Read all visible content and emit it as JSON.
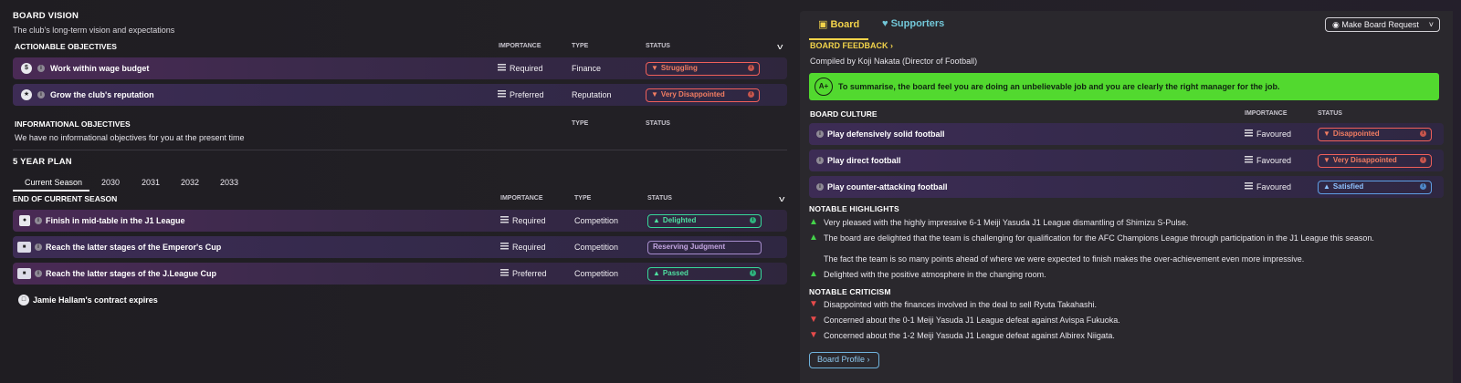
{
  "vision": {
    "title": "BOARD VISION",
    "subtitle": "The club's long-term vision and expectations"
  },
  "actionable": {
    "header": "ACTIONABLE OBJECTIVES",
    "col_importance": "IMPORTANCE",
    "col_type": "TYPE",
    "col_status": "STATUS",
    "items": [
      {
        "label": "Work within wage budget",
        "importance": "Required",
        "type": "Finance",
        "status": "Struggling",
        "status_color": "#f0605a"
      },
      {
        "label": "Grow the club's reputation",
        "importance": "Preferred",
        "type": "Reputation",
        "status": "Very Disappointed",
        "status_color": "#f0605a"
      }
    ]
  },
  "informational": {
    "header": "INFORMATIONAL OBJECTIVES",
    "col_type": "TYPE",
    "col_status": "STATUS",
    "text": "We have no informational objectives for you at the present time"
  },
  "plan": {
    "header": "5 YEAR PLAN",
    "tabs": [
      "Current Season",
      "2030",
      "2031",
      "2032",
      "2033"
    ],
    "section_header": "END OF CURRENT SEASON",
    "col_importance": "IMPORTANCE",
    "col_type": "TYPE",
    "col_status": "STATUS",
    "items": [
      {
        "label": "Finish in mid-table in the J1 League",
        "importance": "Required",
        "type": "Competition",
        "status": "Delighted",
        "status_color": "#37d89a"
      },
      {
        "label": "Reach the latter stages of the Emperor's Cup",
        "importance": "Required",
        "type": "Competition",
        "status": "Reserving Judgment",
        "status_color": "#a68ccc"
      },
      {
        "label": "Reach the latter stages of the J.League Cup",
        "importance": "Preferred",
        "type": "Competition",
        "status": "Passed",
        "status_color": "#37d89a"
      }
    ],
    "contract_note": "Jamie Hallam's contract expires"
  },
  "right": {
    "tab_board": "Board",
    "tab_supporters": "Supporters",
    "request_button": "Make Board Request",
    "feedback_title": "BOARD FEEDBACK",
    "compiled_by": "Compiled by Koji Nakata (Director of Football)",
    "grade": "A+",
    "summary": "To summarise, the board feel you are doing an unbelievable job and you are clearly the right manager for the job.",
    "culture": {
      "header": "BOARD CULTURE",
      "col_importance": "IMPORTANCE",
      "col_status": "STATUS",
      "items": [
        {
          "label": "Play defensively solid football",
          "importance": "Favoured",
          "status": "Disappointed",
          "status_color": "#f0605a"
        },
        {
          "label": "Play direct football",
          "importance": "Favoured",
          "status": "Very Disappointed",
          "status_color": "#f0605a"
        },
        {
          "label": "Play counter-attacking football",
          "importance": "Favoured",
          "status": "Satisfied",
          "status_color": "#5f9fe6"
        }
      ]
    },
    "highlights": {
      "header": "NOTABLE HIGHLIGHTS",
      "items": [
        "Very pleased with the highly impressive 6-1 Meiji Yasuda J1 League dismantling of Shimizu S-Pulse.",
        "The board are delighted that the team is challenging for qualification for the AFC Champions League through participation in the J1 League this season.",
        "The fact the team is so many points ahead of where we were expected to finish makes the over-achievement even more impressive.",
        "Delighted with the positive atmosphere in the changing room."
      ]
    },
    "criticism": {
      "header": "NOTABLE CRITICISM",
      "items": [
        "Disappointed with the finances involved in the deal to sell Ryuta Takahashi.",
        "Concerned about the 0-1 Meiji Yasuda J1 League defeat against Avispa Fukuoka.",
        "Concerned about the 1-2 Meiji Yasuda J1 League defeat against Albirex Niigata."
      ]
    },
    "profile_button": "Board Profile"
  }
}
